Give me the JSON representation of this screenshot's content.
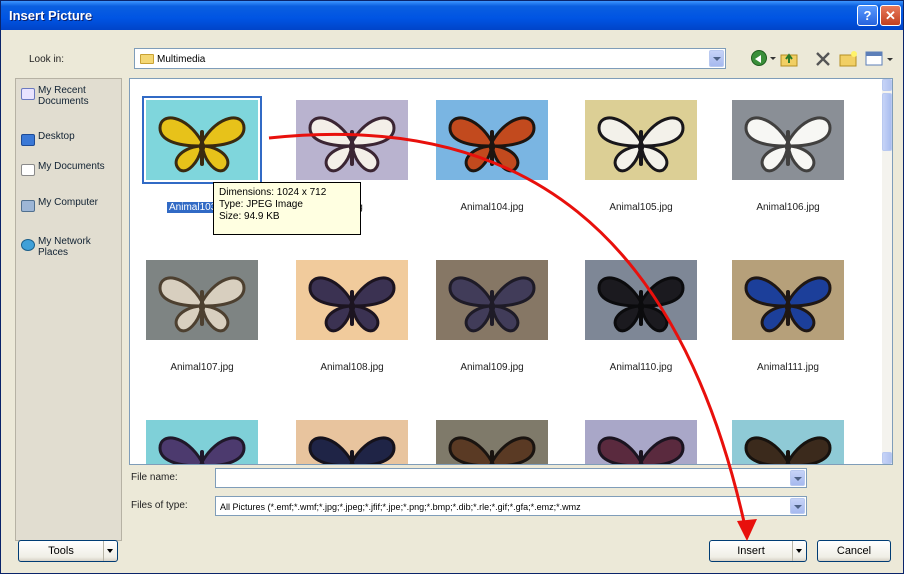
{
  "window": {
    "title": "Insert Picture",
    "help_glyph": "?",
    "close_glyph": "✕"
  },
  "look_in": {
    "label": "Look in:",
    "value": "Multimedia"
  },
  "toolbar": {
    "icons": [
      "back-icon",
      "up-folder-icon",
      "delete-icon",
      "new-folder-icon",
      "views-icon"
    ]
  },
  "places": [
    {
      "label": "My Recent Documents",
      "icon": "recent-documents-icon"
    },
    {
      "label": "Desktop",
      "icon": "desktop-icon"
    },
    {
      "label": "My Documents",
      "icon": "my-documents-icon"
    },
    {
      "label": "My Computer",
      "icon": "my-computer-icon"
    },
    {
      "label": "My Network Places",
      "icon": "network-places-icon"
    }
  ],
  "files": [
    {
      "name": "Animal103.jpg",
      "display": "Animal103",
      "bg": "#7fd6dc",
      "wing": "#e7c21a",
      "edge": "#3a2a10",
      "selected": true
    },
    {
      "name": "Animal103.jpg",
      "display": "3.jpg",
      "bg": "#b9b3cf",
      "wing": "#f4efe8",
      "edge": "#3b2533"
    },
    {
      "name": "Animal104.jpg",
      "display": "Animal104.jpg",
      "bg": "#7ab5e2",
      "wing": "#c24a1e",
      "edge": "#1d1510"
    },
    {
      "name": "Animal105.jpg",
      "display": "Animal105.jpg",
      "bg": "#dccf95",
      "wing": "#f3f1ea",
      "edge": "#18161a"
    },
    {
      "name": "Animal106.jpg",
      "display": "Animal106.jpg",
      "bg": "#8a8f96",
      "wing": "#f7f7f4",
      "edge": "#41403f"
    },
    {
      "name": "Animal107.jpg",
      "display": "Animal107.jpg",
      "bg": "#7e8483",
      "wing": "#d8cfbf",
      "edge": "#4d4030"
    },
    {
      "name": "Animal108.jpg",
      "display": "Animal108.jpg",
      "bg": "#f1cb9c",
      "wing": "#3b3252",
      "edge": "#1c1420"
    },
    {
      "name": "Animal109.jpg",
      "display": "Animal109.jpg",
      "bg": "#867765",
      "wing": "#413c59",
      "edge": "#1e1b27"
    },
    {
      "name": "Animal110.jpg",
      "display": "Animal110.jpg",
      "bg": "#7e8796",
      "wing": "#1b1a1f",
      "edge": "#0b0b0d"
    },
    {
      "name": "Animal111.jpg",
      "display": "Animal111.jpg",
      "bg": "#b6a07a",
      "wing": "#1c3f9a",
      "edge": "#1f1714"
    },
    {
      "name": "",
      "display": "",
      "bg": "#7fd0d8",
      "wing": "#4c3a6e",
      "edge": "#20182a"
    },
    {
      "name": "",
      "display": "",
      "bg": "#e8c49e",
      "wing": "#1f2446",
      "edge": "#15121c"
    },
    {
      "name": "",
      "display": "",
      "bg": "#7f7a6a",
      "wing": "#5a3a24",
      "edge": "#1a1410"
    },
    {
      "name": "",
      "display": "",
      "bg": "#a9a7c8",
      "wing": "#5a2a3e",
      "edge": "#1b1420"
    },
    {
      "name": "",
      "display": "",
      "bg": "#8fcad6",
      "wing": "#3b2a1c",
      "edge": "#17120e"
    }
  ],
  "tooltip": {
    "dimensions": "Dimensions: 1024 x 712",
    "type": "Type: JPEG Image",
    "size": "Size: 94.9 KB"
  },
  "file_name": {
    "label": "File name:",
    "value": ""
  },
  "files_of_type": {
    "label": "Files of type:",
    "value": "All Pictures (*.emf;*.wmf;*.jpg;*.jpeg;*.jfif;*.jpe;*.png;*.bmp;*.dib;*.rle;*.gif;*.gfa;*.emz;*.wmz"
  },
  "buttons": {
    "tools": "Tools",
    "insert": "Insert",
    "cancel": "Cancel"
  },
  "annotation": {
    "color": "#e8100c"
  }
}
